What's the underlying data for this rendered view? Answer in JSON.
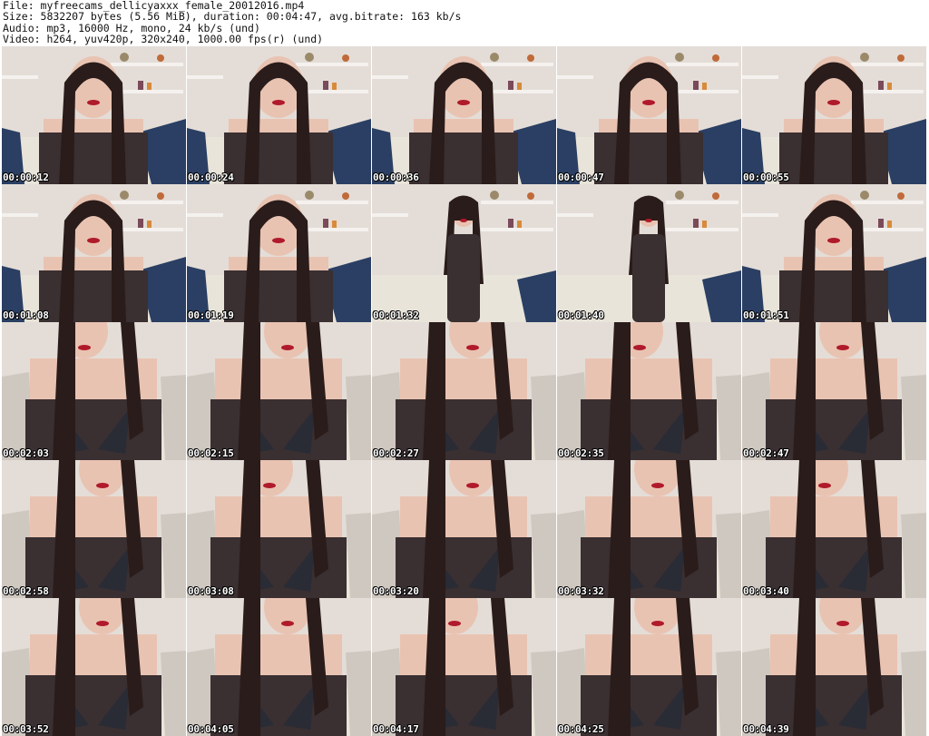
{
  "info": {
    "file": "File: myfreecams_dellicyaxxx_female_20012016.mp4",
    "size": "Size: 5832207 bytes (5.56 MiB), duration: 00:04:47, avg.bitrate: 163 kb/s",
    "audio": "Audio: mp3, 16000 Hz, mono, 24 kb/s (und)",
    "video": "Video: h264, yuv420p, 320x240, 1000.00 fps(r) (und)"
  },
  "thumbnails": [
    {
      "time": "00:00:12",
      "scene": "close"
    },
    {
      "time": "00:00:24",
      "scene": "close"
    },
    {
      "time": "00:00:36",
      "scene": "close"
    },
    {
      "time": "00:00:47",
      "scene": "close"
    },
    {
      "time": "00:00:55",
      "scene": "close"
    },
    {
      "time": "00:01:08",
      "scene": "close"
    },
    {
      "time": "00:01:19",
      "scene": "close"
    },
    {
      "time": "00:01:32",
      "scene": "standing"
    },
    {
      "time": "00:01:40",
      "scene": "standing"
    },
    {
      "time": "00:01:51",
      "scene": "close"
    },
    {
      "time": "00:02:03",
      "scene": "near"
    },
    {
      "time": "00:02:15",
      "scene": "near"
    },
    {
      "time": "00:02:27",
      "scene": "near"
    },
    {
      "time": "00:02:35",
      "scene": "near"
    },
    {
      "time": "00:02:47",
      "scene": "near"
    },
    {
      "time": "00:02:58",
      "scene": "near"
    },
    {
      "time": "00:03:08",
      "scene": "near"
    },
    {
      "time": "00:03:20",
      "scene": "near"
    },
    {
      "time": "00:03:32",
      "scene": "near"
    },
    {
      "time": "00:03:40",
      "scene": "near"
    },
    {
      "time": "00:03:52",
      "scene": "near"
    },
    {
      "time": "00:04:05",
      "scene": "near"
    },
    {
      "time": "00:04:17",
      "scene": "near"
    },
    {
      "time": "00:04:25",
      "scene": "near"
    },
    {
      "time": "00:04:39",
      "scene": "near"
    }
  ],
  "colors": {
    "wall": "#e4ddd7",
    "shelf": "#f4f1ee",
    "cushion": "#2a3f63",
    "couch": "#e9e4da",
    "hair": "#2a1c1a",
    "skin": "#e9c3b2",
    "top": "#3a2f31",
    "lips": "#b01a2a",
    "timestamp": "#ffffff"
  }
}
